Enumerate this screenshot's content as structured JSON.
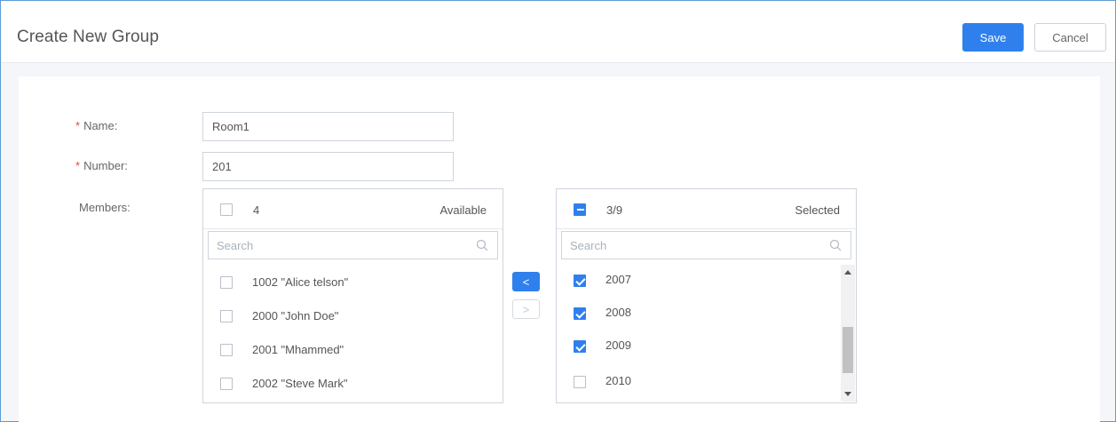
{
  "header": {
    "title": "Create New Group",
    "save_label": "Save",
    "cancel_label": "Cancel"
  },
  "form": {
    "name_label": "Name:",
    "name_value": "Room1",
    "number_label": "Number:",
    "number_value": "201",
    "members_label": "Members:",
    "required_mark": "*"
  },
  "available": {
    "count": "4",
    "title": "Available",
    "search_placeholder": "Search",
    "items": [
      {
        "label": "1002 \"Alice telson\"",
        "checked": false
      },
      {
        "label": "2000 \"John Doe\"",
        "checked": false
      },
      {
        "label": "2001 \"Mhammed\"",
        "checked": false
      },
      {
        "label": "2002 \"Steve Mark\"",
        "checked": false
      }
    ]
  },
  "selected": {
    "count": "3/9",
    "title": "Selected",
    "search_placeholder": "Search",
    "items": [
      {
        "label": "2007",
        "checked": true
      },
      {
        "label": "2008",
        "checked": true
      },
      {
        "label": "2009",
        "checked": true
      },
      {
        "label": "2010",
        "checked": false
      }
    ]
  },
  "transfer": {
    "left_glyph": "<",
    "right_glyph": ">"
  },
  "colors": {
    "accent": "#2f80ed",
    "required": "#e84545",
    "frame": "#5b9bd5"
  }
}
